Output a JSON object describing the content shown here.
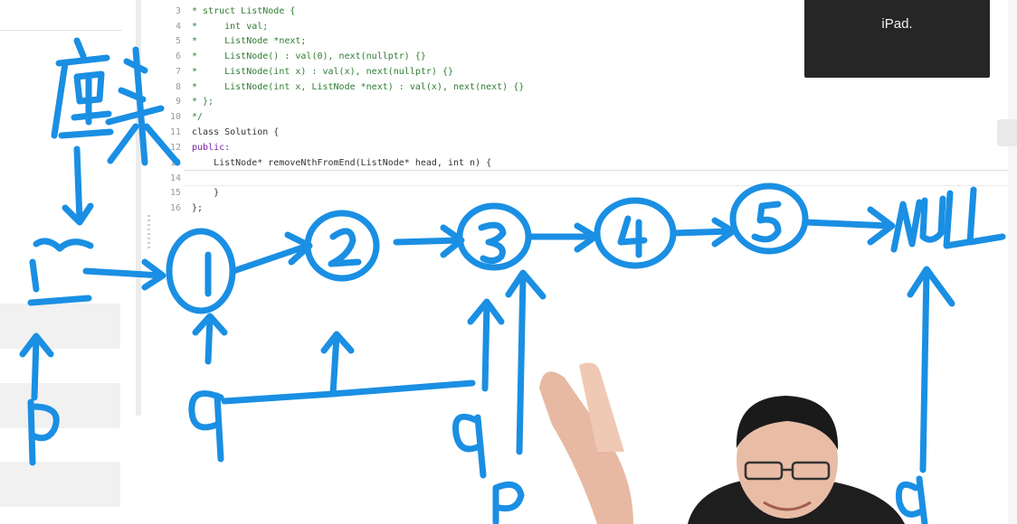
{
  "editor": {
    "lines": [
      {
        "num": "3",
        "text": "* struct ListNode {",
        "kind": "comment"
      },
      {
        "num": "4",
        "text": "*     int val;",
        "kind": "comment"
      },
      {
        "num": "5",
        "text": "*     ListNode *next;",
        "kind": "comment"
      },
      {
        "num": "6",
        "text": "*     ListNode() : val(0), next(nullptr) {}",
        "kind": "comment"
      },
      {
        "num": "7",
        "text": "*     ListNode(int x) : val(x), next(nullptr) {}",
        "kind": "comment"
      },
      {
        "num": "8",
        "text": "*     ListNode(int x, ListNode *next) : val(x), next(next) {}",
        "kind": "comment"
      },
      {
        "num": "9",
        "text": "* };",
        "kind": "comment"
      },
      {
        "num": "10",
        "text": "*/",
        "kind": "comment"
      },
      {
        "num": "11",
        "text": "class Solution {",
        "kind": "plain"
      },
      {
        "num": "12",
        "text": "public:",
        "kind": "kw"
      },
      {
        "num": "13",
        "text": "    ListNode* removeNthFromEnd(ListNode* head, int n) {",
        "kind": "plain"
      },
      {
        "num": "14",
        "text": "",
        "kind": "plain"
      },
      {
        "num": "15",
        "text": "    }",
        "kind": "plain"
      },
      {
        "num": "16",
        "text": "};",
        "kind": "plain"
      }
    ]
  },
  "ipad_overlay": {
    "label": "iPad."
  },
  "colors": {
    "ink": "#1a8fe3",
    "overlay_bg": "#262626",
    "comment": "#2e7d32"
  },
  "drawing": {
    "nodes": [
      "1",
      "2",
      "3",
      "4",
      "5"
    ],
    "dummy_label": "虚头",
    "tail_label": "NULL",
    "pointers": [
      "p",
      "q",
      "q",
      "p",
      "q"
    ]
  }
}
